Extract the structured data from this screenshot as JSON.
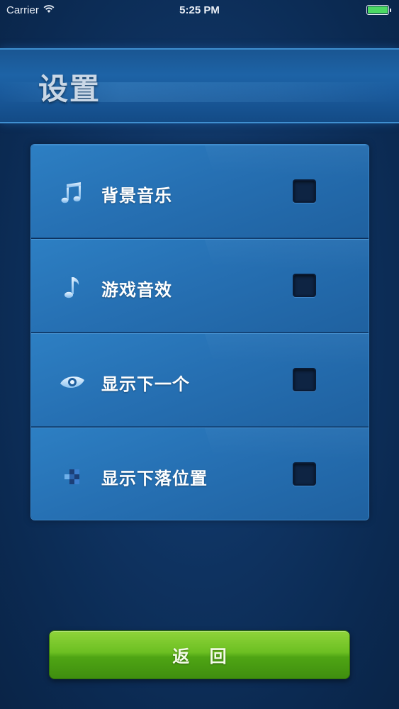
{
  "status_bar": {
    "carrier": "Carrier",
    "time": "5:25 PM",
    "wifi_icon": "wifi-icon",
    "battery_icon": "battery-icon",
    "battery_color": "#4cd964"
  },
  "header": {
    "title": "设置"
  },
  "settings": [
    {
      "icon": "music-notes-icon",
      "label": "背景音乐",
      "checked": false
    },
    {
      "icon": "music-note-icon",
      "label": "游戏音效",
      "checked": false
    },
    {
      "icon": "eye-icon",
      "label": "显示下一个",
      "checked": false
    },
    {
      "icon": "drop-position-icon",
      "label": "显示下落位置",
      "checked": false
    }
  ],
  "back_button": {
    "label": "返 回",
    "color": "#5cb31a"
  },
  "colors": {
    "background": "#0f3463",
    "panel": "#2670b3",
    "checkbox": "#0e2443"
  }
}
